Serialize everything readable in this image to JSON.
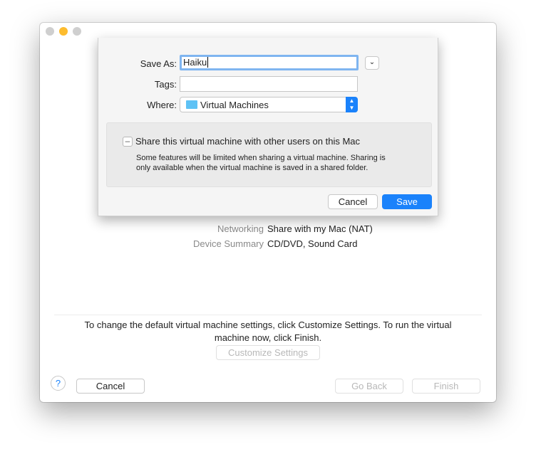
{
  "window": {
    "controls": [
      "close",
      "minimize",
      "zoom"
    ]
  },
  "summary": {
    "rows": [
      {
        "label": "Networking",
        "value": "Share with my Mac (NAT)"
      },
      {
        "label": "Device Summary",
        "value": "CD/DVD, Sound Card"
      }
    ]
  },
  "footer": {
    "info": "To change the default virtual machine settings, click Customize Settings. To run the virtual machine now, click Finish.",
    "customize": "Customize Settings",
    "help": "?",
    "cancel": "Cancel",
    "back": "Go Back",
    "finish": "Finish"
  },
  "sheet": {
    "save_as_label": "Save As:",
    "save_as_value": "Haiku",
    "tags_label": "Tags:",
    "tags_value": "",
    "where_label": "Where:",
    "where_value": "Virtual Machines",
    "share_label": "Share this virtual machine with other users on this Mac",
    "share_note": "Some features will be limited when sharing a virtual machine. Sharing is only available when the virtual machine is saved in a shared folder.",
    "cancel": "Cancel",
    "save": "Save"
  },
  "colors": {
    "accent": "#1a82fb",
    "folder": "#5ec2f5"
  }
}
